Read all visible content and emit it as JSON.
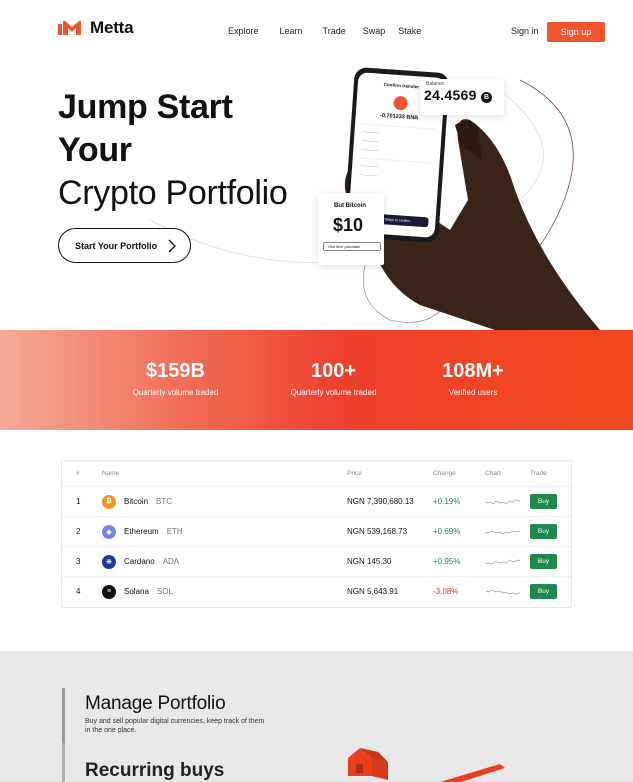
{
  "brand": {
    "name": "Metta",
    "accent": "#f2542d"
  },
  "nav": {
    "links": [
      "Explore",
      "Learn",
      "Trade",
      "Swap",
      "Stake"
    ],
    "signin": "Sign in",
    "signup": "Sign up"
  },
  "hero": {
    "line1": "Jump Start",
    "line2": "Your",
    "line3": "Crypto Portfolio",
    "cta": "Start Your Portfolio"
  },
  "phone": {
    "header": "Confirm transfer",
    "amount": "-0,701233 BNB",
    "button": "Swipe to confirm"
  },
  "balance_card": {
    "label": "Balance",
    "value": "24.4569",
    "coin": "B"
  },
  "buy_card": {
    "label": "But Bitcoin",
    "value": "$10",
    "select": "One time purchase"
  },
  "stats": [
    {
      "value": "$159B",
      "label": "Quarterly volume traded"
    },
    {
      "value": "100+",
      "label": "Quarterly volume traded"
    },
    {
      "value": "108M+",
      "label": "Verified users"
    }
  ],
  "table": {
    "headers": {
      "num": "#",
      "name": "Name",
      "price": "Price",
      "change": "Change",
      "chart": "Chart",
      "trade": "Trade"
    },
    "buy_label": "Buy",
    "rows": [
      {
        "num": "1",
        "name": "Bitcoin",
        "ticker": "BTC",
        "price": "NGN 7,390,680.13",
        "change": "+0.19%",
        "icon": "bitcoin-icon",
        "color": "#f39321"
      },
      {
        "num": "2",
        "name": "Ethereum",
        "ticker": "ETH",
        "price": "NGN 539,168.73",
        "change": "+0.69%",
        "icon": "ethereum-icon",
        "color": "#7b85e6"
      },
      {
        "num": "3",
        "name": "Cardano",
        "ticker": "ADA",
        "price": "NGN 145.30",
        "change": "+0.95%",
        "icon": "cardano-icon",
        "color": "#1b3a9a"
      },
      {
        "num": "4",
        "name": "Solana",
        "ticker": "SOL",
        "price": "NGN 5,643.91",
        "change": "-3.08%",
        "icon": "solana-icon",
        "color": "#111111"
      }
    ]
  },
  "manage": {
    "title": "Manage Portfolio",
    "subtitle": "Buy and sell popular digital currencies, keep track of them in the one place.",
    "title2": "Recurring buys"
  }
}
